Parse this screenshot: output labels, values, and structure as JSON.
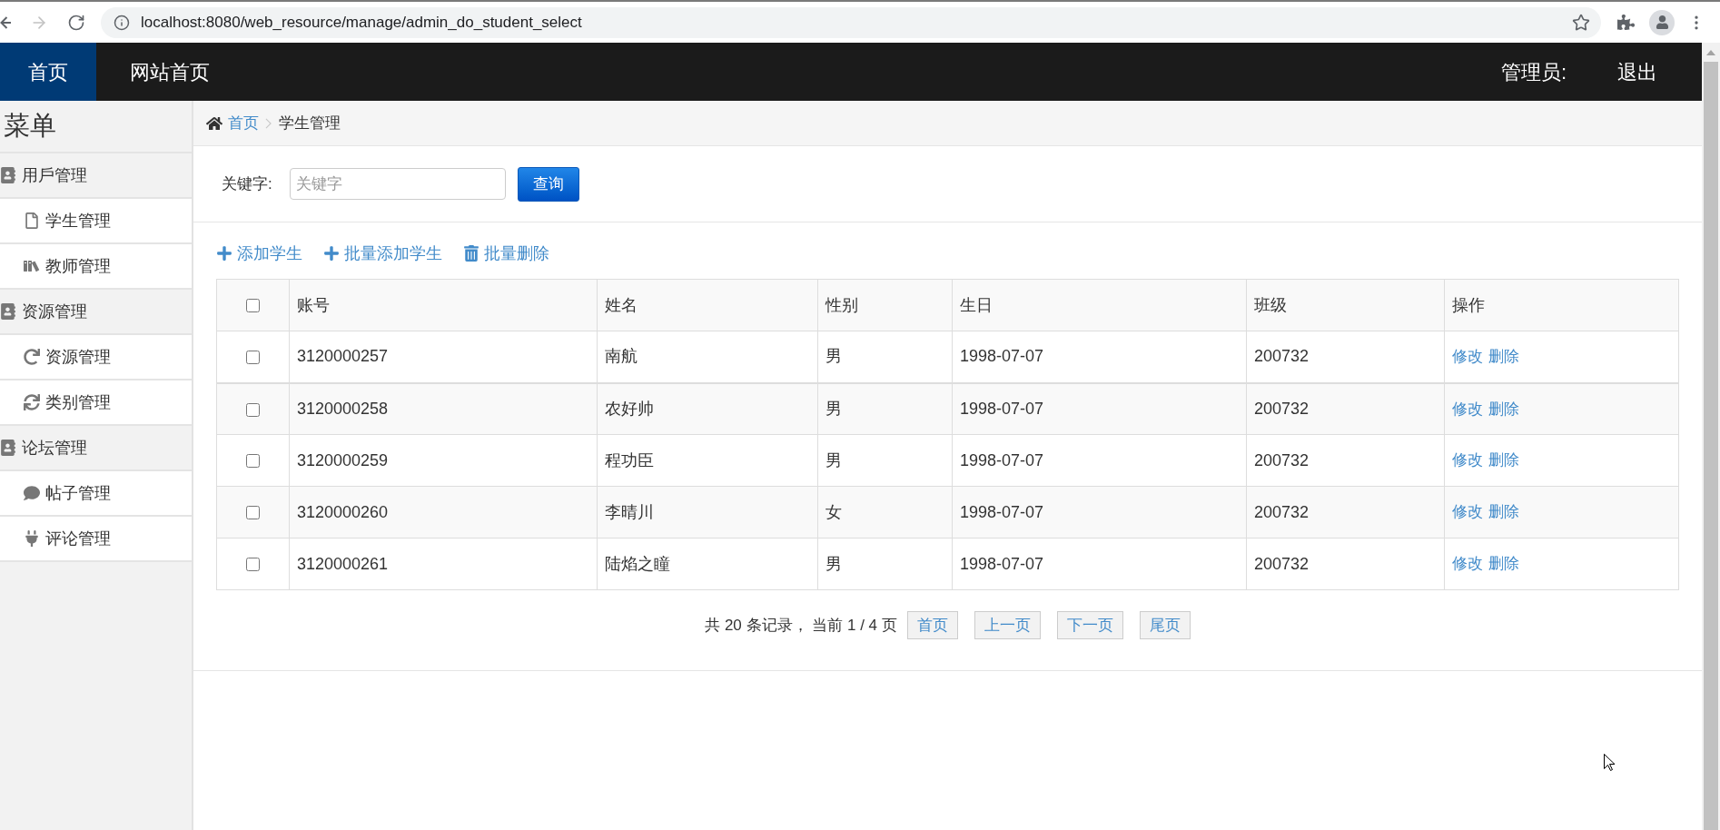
{
  "browser": {
    "url": "localhost:8080/web_resource/manage/admin_do_student_select"
  },
  "navbar": {
    "items": [
      {
        "label": "首页",
        "selected": true
      },
      {
        "label": "网站首页",
        "selected": false
      }
    ],
    "user_label": "管理员:",
    "logout": "退出"
  },
  "sidebar": {
    "title": "菜单",
    "groups": [
      {
        "label": "用戶管理",
        "children": [
          {
            "label": "学生管理"
          },
          {
            "label": "教师管理"
          }
        ]
      },
      {
        "label": "资源管理",
        "children": [
          {
            "label": "资源管理"
          },
          {
            "label": "类别管理"
          }
        ]
      },
      {
        "label": "论坛管理",
        "children": [
          {
            "label": "帖子管理"
          },
          {
            "label": "评论管理"
          }
        ]
      }
    ]
  },
  "breadcrumb": [
    "首页",
    "学生管理"
  ],
  "search": {
    "label": "关键字:",
    "placeholder": "关键字",
    "button": "查询"
  },
  "toolbar": [
    "添加学生",
    "批量添加学生",
    "批量删除"
  ],
  "table": {
    "select_all": {
      "checked": false
    },
    "columns": [
      "账号",
      "姓名",
      "性别",
      "生日",
      "班级",
      "操作"
    ],
    "rows": [
      {
        "checked": false,
        "cells": [
          "3120000257",
          "南航",
          "男",
          "1998-07-07",
          "200732"
        ],
        "actions": [
          "修改",
          "删除"
        ]
      },
      {
        "checked": false,
        "cells": [
          "3120000258",
          "农好帅",
          "男",
          "1998-07-07",
          "200732"
        ],
        "actions": [
          "修改",
          "删除"
        ]
      },
      {
        "checked": false,
        "cells": [
          "3120000259",
          "程功臣",
          "男",
          "1998-07-07",
          "200732"
        ],
        "actions": [
          "修改",
          "删除"
        ]
      },
      {
        "checked": false,
        "cells": [
          "3120000260",
          "李晴川",
          "女",
          "1998-07-07",
          "200732"
        ],
        "actions": [
          "修改",
          "删除"
        ]
      },
      {
        "checked": false,
        "cells": [
          "3120000261",
          "陆焰之瞳",
          "男",
          "1998-07-07",
          "200732"
        ],
        "actions": [
          "修改",
          "删除"
        ]
      }
    ]
  },
  "pagination": {
    "summary": "共 20 条记录， 当前 1 / 4 页",
    "buttons": [
      "首页",
      "上一页",
      "下一页",
      "尾页"
    ]
  }
}
